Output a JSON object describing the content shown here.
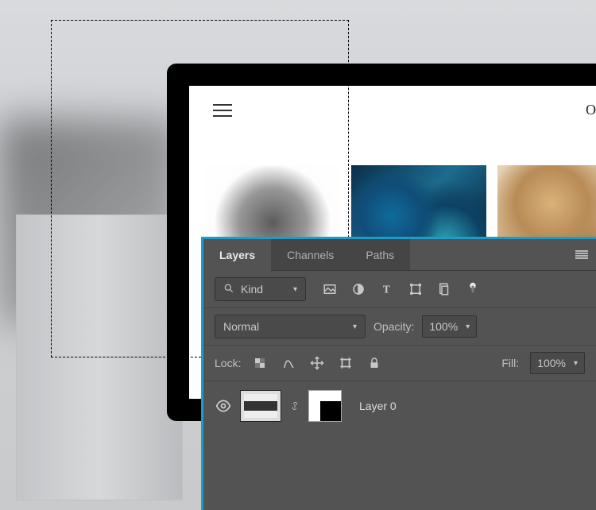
{
  "mockup": {
    "site_title": "Obsidian"
  },
  "panel": {
    "tabs": {
      "layers": "Layers",
      "channels": "Channels",
      "paths": "Paths"
    },
    "filter": {
      "kind_label": "Kind",
      "icons": {
        "image": "image-filter-icon",
        "adjust": "adjustment-filter-icon",
        "text": "type-filter-icon",
        "shape": "shape-filter-icon",
        "smart": "smartobject-filter-icon"
      }
    },
    "blend": {
      "mode": "Normal",
      "opacity_label": "Opacity:",
      "opacity_value": "100%"
    },
    "lock": {
      "label": "Lock:",
      "fill_label": "Fill:",
      "fill_value": "100%"
    },
    "layers": [
      {
        "name": "Layer 0",
        "visible": true
      }
    ]
  }
}
